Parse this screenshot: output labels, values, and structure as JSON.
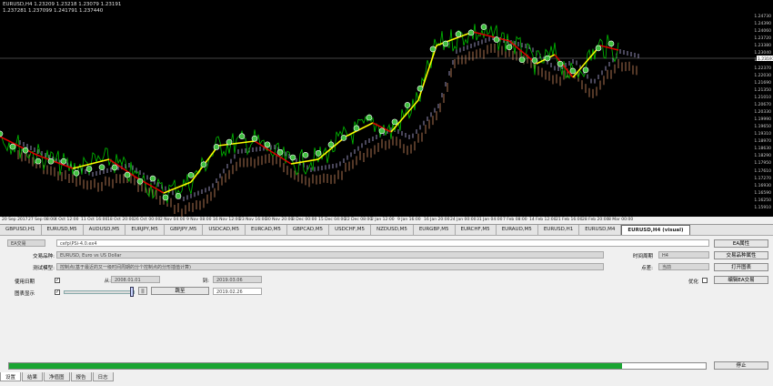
{
  "chart": {
    "title": "EURUSD,H4  1.23209 1.23218 1.23079 1.23191",
    "subtitle": "1.237281 1.237099 1.241791 1.237440",
    "price_labels": [
      "1.24730",
      "1.24390",
      "1.24060",
      "1.23720",
      "1.23380",
      "1.23040",
      "1.22700",
      "1.22370",
      "1.22030",
      "1.21690",
      "1.21350",
      "1.21010",
      "1.20670",
      "1.20330",
      "1.19990",
      "1.19650",
      "1.19310",
      "1.18970",
      "1.18630",
      "1.18290",
      "1.17950",
      "1.17610",
      "1.17270",
      "1.16930",
      "1.16590",
      "1.16250",
      "1.15910"
    ],
    "current_price": "1.23191",
    "time_labels": [
      "20 Sep 2017",
      "27 Sep 08:00",
      "4 Oct 12:00",
      "11 Oct 16:00",
      "18 Oct 20:00",
      "26 Oct 00:00",
      "2 Nov 04:00",
      "9 Nov 08:00",
      "16 Nov 12:00",
      "23 Nov 16:00",
      "30 Nov 20:00",
      "8 Dec 00:00",
      "15 Dec 04:00",
      "22 Dec 08:00",
      "2 Jan 12:00",
      "9 Jan 16:00",
      "16 Jan 20:00",
      "24 Jan 00:00",
      "31 Jan 04:00",
      "7 Feb 08:00",
      "14 Feb 12:00",
      "21 Feb 16:00",
      "28 Feb 20:00",
      "8 Mar 00:00"
    ],
    "colors": {
      "background": "#000000",
      "price": "#00c000",
      "ma_up": "#ffff00",
      "ma_down": "#dd0000",
      "cloud_a": "#f0a070",
      "cloud_b": "#d0c8ff",
      "marker": "#40c040"
    }
  },
  "tabs": [
    "GBPUSD,H1",
    "EURUSD,M5",
    "AUDUSD,M5",
    "EURJPY,M5",
    "GBPJPY,M5",
    "USDCAD,M5",
    "EURCAD,M5",
    "GBPCAD,M5",
    "USDCHF,M5",
    "NZDUSD,M5",
    "EURGBP,M5",
    "EURCHF,M5",
    "EURAUD,M5",
    "EURUSD,H1",
    "EURUSD,M4",
    "EURUSD,H4 (visual)"
  ],
  "tester": {
    "ea_label": "EA交易",
    "ea_value": "cefp\\PSi-4.0.ex4",
    "symbol_label": "交易品种:",
    "symbol_value": "EURUSD, Euro vs US Dollar",
    "model_label": "测试模型:",
    "model_value": "控制点(基于最近的又一级时间周期的分个控制点的分形插值计算)",
    "use_date_label": "使用日期",
    "from_label": "从:",
    "from_value": "2008.01.01",
    "to_label": "到:",
    "to_value": "2019.03.06",
    "visual_label": "图表显示",
    "pause_label": "||",
    "skip_label": "跳至",
    "skip_date": "2019.02.26",
    "period_label": "时间周期",
    "period_value": "H4",
    "spread_label": "点差:",
    "spread_value": "当前",
    "optimize_label": "优化",
    "btn_ea_props": "EA属性",
    "btn_symbol_props": "交易品种属性",
    "btn_open_chart": "打开图表",
    "btn_modify_ea": "编辑EA交易",
    "btn_stop": "停止",
    "progress": 0.88
  },
  "bottom_tabs": [
    "设置",
    "结果",
    "净值图",
    "报告",
    "日志"
  ]
}
